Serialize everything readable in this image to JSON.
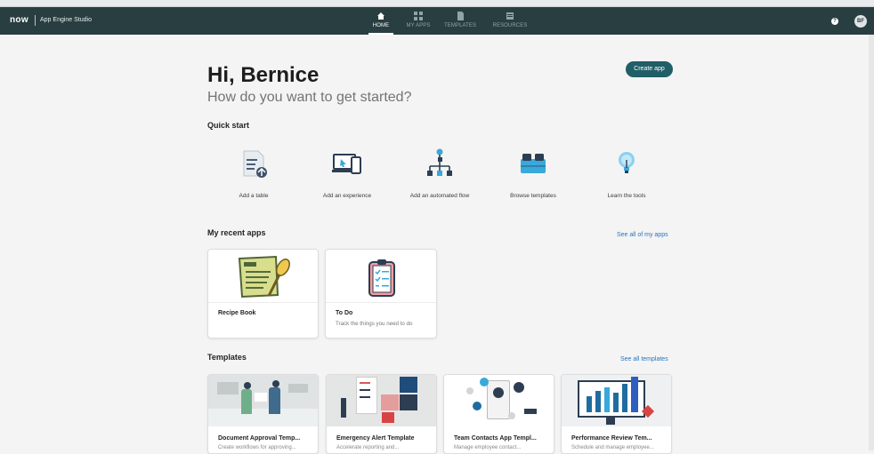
{
  "header": {
    "logo": "now",
    "app_name": "App Engine Studio",
    "nav": [
      {
        "label": "HOME",
        "icon": "home-icon",
        "active": true
      },
      {
        "label": "MY APPS",
        "icon": "grid-icon",
        "active": false
      },
      {
        "label": "TEMPLATES",
        "icon": "document-icon",
        "active": false
      },
      {
        "label": "RESOURCES",
        "icon": "book-icon",
        "active": false
      }
    ],
    "help_icon": "?",
    "avatar": "BF"
  },
  "hero": {
    "greeting": "Hi, Bernice",
    "subtitle": "How do you want to get started?",
    "create_button": "Create app"
  },
  "quick_start": {
    "title": "Quick start",
    "items": [
      {
        "label": "Add a table",
        "icon": "table-add-icon"
      },
      {
        "label": "Add an experience",
        "icon": "devices-icon"
      },
      {
        "label": "Add an automated flow",
        "icon": "flow-icon"
      },
      {
        "label": "Browse templates",
        "icon": "templates-icon"
      },
      {
        "label": "Learn the tools",
        "icon": "lightbulb-icon"
      }
    ]
  },
  "recent_apps": {
    "title": "My recent apps",
    "link": "See all of my apps",
    "items": [
      {
        "title": "Recipe Book",
        "subtitle": "",
        "icon": "recipe-icon"
      },
      {
        "title": "To Do",
        "subtitle": "Track the things you need to do",
        "icon": "clipboard-icon"
      }
    ]
  },
  "templates": {
    "title": "Templates",
    "link": "See all templates",
    "items": [
      {
        "title": "Document Approval Temp...",
        "subtitle": "Create workflows for approving..."
      },
      {
        "title": "Emergency Alert Template",
        "subtitle": "Accelerate reporting and..."
      },
      {
        "title": "Team Contacts App Templ...",
        "subtitle": "Manage employee contact..."
      },
      {
        "title": "Performance Review Tem...",
        "subtitle": "Schedule and manage employee..."
      }
    ]
  },
  "colors": {
    "header_bg": "#293e40",
    "accent": "#205e68",
    "link": "#2a74c0"
  }
}
